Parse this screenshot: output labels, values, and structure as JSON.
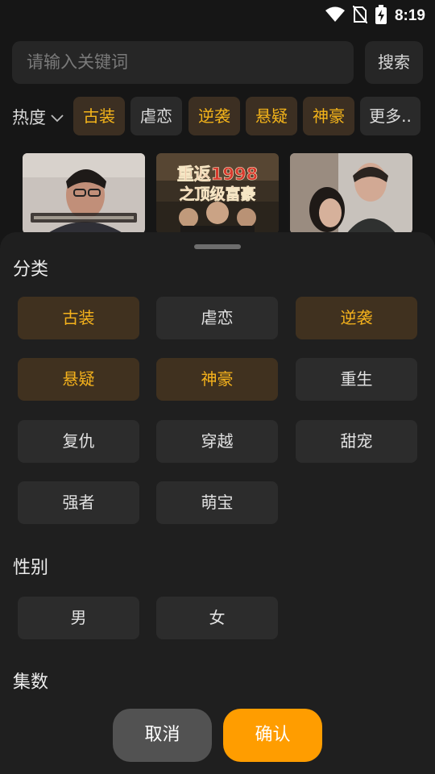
{
  "status_bar": {
    "time": "8:19",
    "icons": [
      "wifi-icon",
      "no-sim-icon",
      "battery-charging-icon"
    ]
  },
  "search": {
    "placeholder": "请输入关键词",
    "button_label": "搜索"
  },
  "sort": {
    "label": "热度",
    "icon": "chevron-down-icon"
  },
  "tags": [
    {
      "label": "古装",
      "active": true
    },
    {
      "label": "虐恋",
      "active": false
    },
    {
      "label": "逆袭",
      "active": true
    },
    {
      "label": "悬疑",
      "active": true
    },
    {
      "label": "神豪",
      "active": true
    },
    {
      "label": "更多..",
      "active": false
    }
  ],
  "thumbnails": [
    {
      "caption": ""
    },
    {
      "caption": "重返1998 之顶级富豪"
    },
    {
      "caption": ""
    }
  ],
  "filter_sheet": {
    "category_title": "分类",
    "categories": [
      {
        "label": "古装",
        "selected": true
      },
      {
        "label": "虐恋",
        "selected": false
      },
      {
        "label": "逆袭",
        "selected": true
      },
      {
        "label": "悬疑",
        "selected": true
      },
      {
        "label": "神豪",
        "selected": true
      },
      {
        "label": "重生",
        "selected": false
      },
      {
        "label": "复仇",
        "selected": false
      },
      {
        "label": "穿越",
        "selected": false
      },
      {
        "label": "甜宠",
        "selected": false
      },
      {
        "label": "强者",
        "selected": false
      },
      {
        "label": "萌宝",
        "selected": false
      }
    ],
    "gender_title": "性别",
    "genders": [
      {
        "label": "男",
        "selected": false
      },
      {
        "label": "女",
        "selected": false
      }
    ],
    "episodes_title": "集数",
    "cancel_label": "取消",
    "confirm_label": "确认"
  },
  "colors": {
    "accent": "#ff9d00",
    "selected_text": "#f5b21c",
    "background": "#161616",
    "sheet": "#1f1f1f"
  }
}
